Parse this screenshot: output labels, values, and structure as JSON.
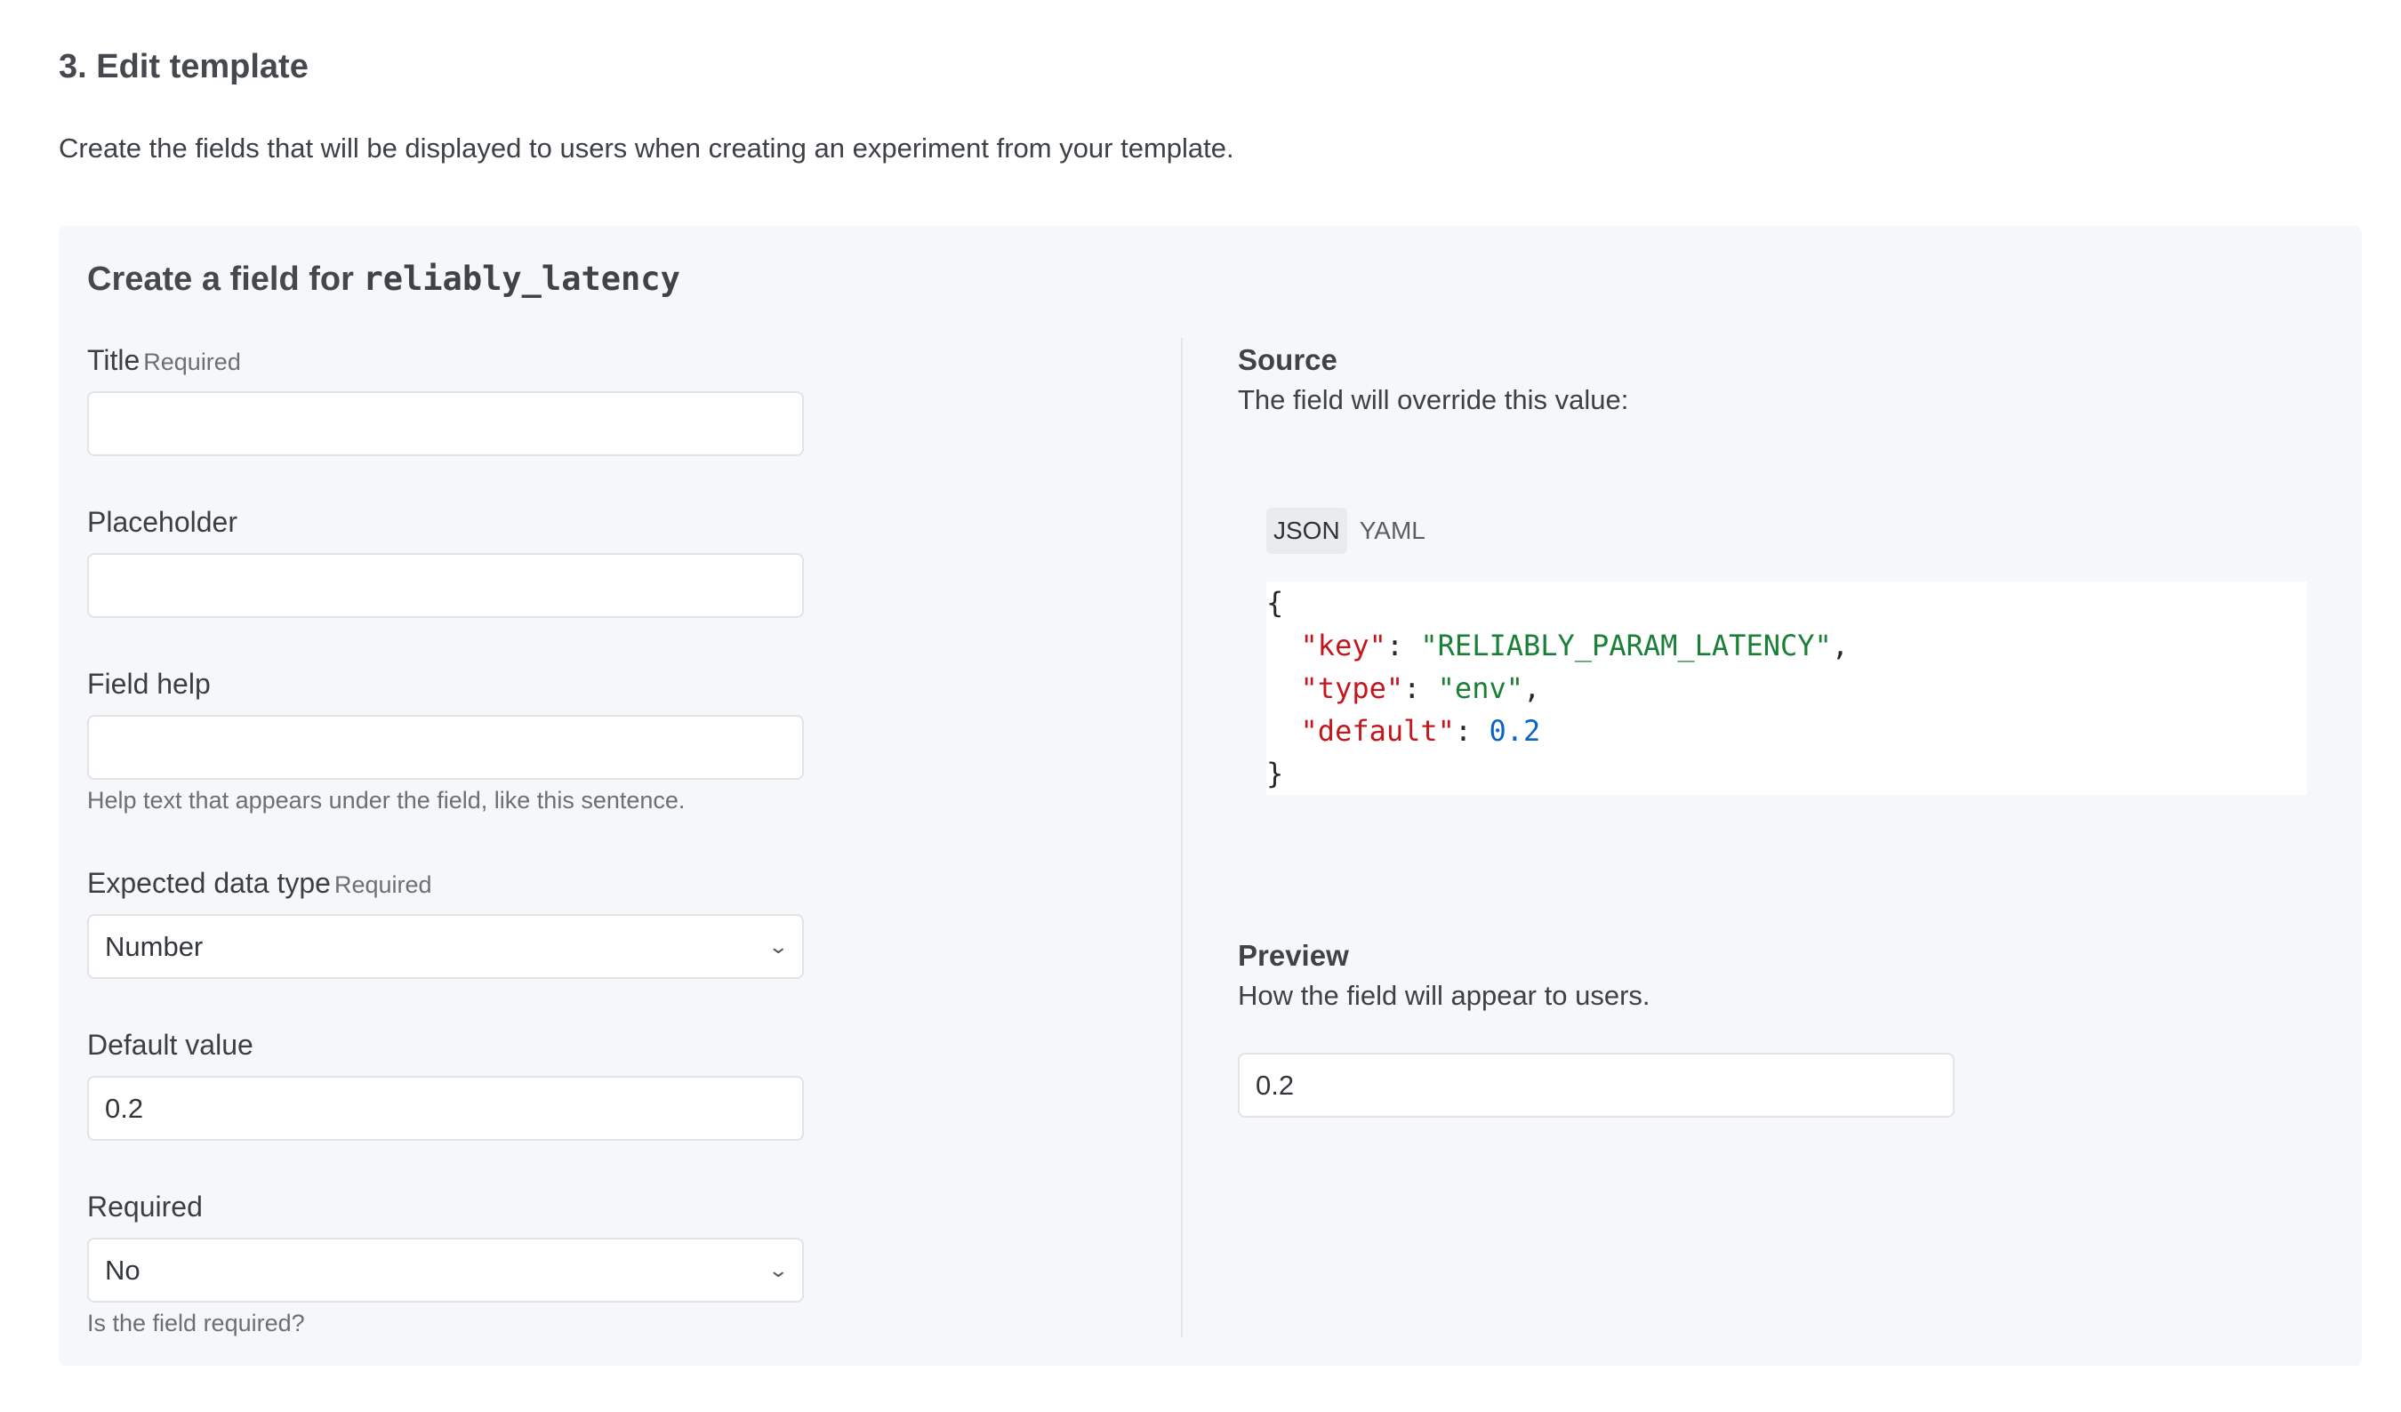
{
  "step": {
    "title": "3. Edit template",
    "description": "Create the fields that will be displayed to users when creating an experiment from your template."
  },
  "panel": {
    "title_prefix": "Create a field for",
    "title_code": "reliably_latency"
  },
  "form": {
    "title": {
      "label": "Title",
      "required_tag": "Required",
      "value": ""
    },
    "placeholder": {
      "label": "Placeholder",
      "value": ""
    },
    "field_help": {
      "label": "Field help",
      "value": "",
      "help": "Help text that appears under the field, like this sentence."
    },
    "data_type": {
      "label": "Expected data type",
      "required_tag": "Required",
      "selected": "Number"
    },
    "default_value": {
      "label": "Default value",
      "value": "0.2"
    },
    "required": {
      "label": "Required",
      "selected": "No",
      "help": "Is the field required?"
    }
  },
  "source": {
    "title": "Source",
    "description": "The field will override this value:",
    "tabs": [
      {
        "label": "JSON",
        "active": true
      },
      {
        "label": "YAML",
        "active": false
      }
    ],
    "json": {
      "open": "{",
      "close": "}",
      "entries": [
        {
          "key": "\"key\"",
          "value": "\"RELIABLY_PARAM_LATENCY\"",
          "kind": "string",
          "comma": ","
        },
        {
          "key": "\"type\"",
          "value": "\"env\"",
          "kind": "string",
          "comma": ","
        },
        {
          "key": "\"default\"",
          "value": "0.2",
          "kind": "number",
          "comma": ""
        }
      ]
    }
  },
  "preview": {
    "title": "Preview",
    "description": "How the field will appear to users.",
    "value": "0.2"
  },
  "colors": {
    "panel_bg": "#f6f7f9",
    "json_key": "#c4161c",
    "json_string": "#1a7f37",
    "json_number": "#0a63c7"
  }
}
